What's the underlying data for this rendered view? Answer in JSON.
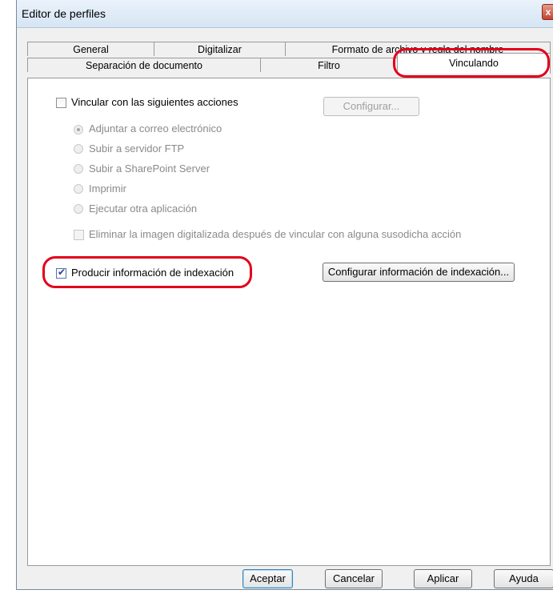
{
  "window": {
    "title": "Editor de perfiles",
    "close_glyph": "x"
  },
  "tabs": {
    "row_top": [
      "General",
      "Digitalizar",
      "Formato de archivo y regla del nombre"
    ],
    "row_bottom": [
      "Separación de documento",
      "Filtro",
      "Vinculando"
    ],
    "active": "Vinculando"
  },
  "link_section": {
    "link_checkbox_label": "Vincular con las siguientes acciones",
    "link_checked": false,
    "configure_button": "Configurar...",
    "actions": [
      "Adjuntar a correo electrónico",
      "Subir a servidor FTP",
      "Subir a SharePoint Server",
      "Imprimir",
      "Ejecutar otra aplicación"
    ],
    "selected_action": "Adjuntar a correo electrónico",
    "delete_checkbox_label": "Eliminar la imagen digitalizada después de vincular con alguna susodicha acción"
  },
  "index_section": {
    "index_checkbox_label": "Producir información de indexación",
    "index_checked": true,
    "configure_index_button": "Configurar información de indexación..."
  },
  "footer": {
    "ok": "Aceptar",
    "cancel": "Cancelar",
    "apply": "Aplicar",
    "help": "Ayuda"
  },
  "highlight_color": "#e2001a"
}
